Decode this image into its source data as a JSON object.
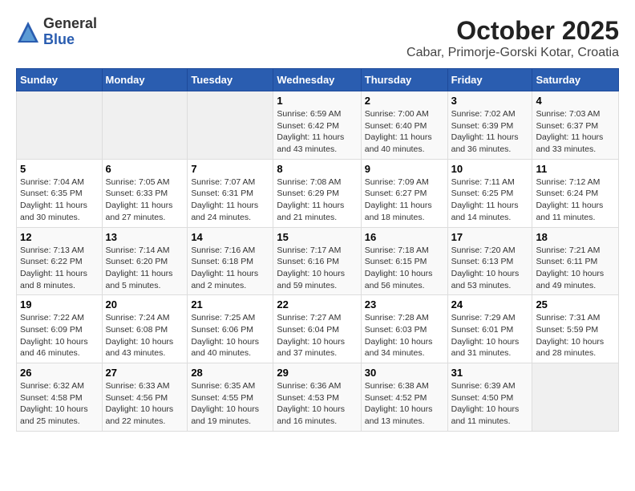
{
  "header": {
    "logo": {
      "general": "General",
      "blue": "Blue"
    },
    "title": "October 2025",
    "subtitle": "Cabar, Primorje-Gorski Kotar, Croatia"
  },
  "days_of_week": [
    "Sunday",
    "Monday",
    "Tuesday",
    "Wednesday",
    "Thursday",
    "Friday",
    "Saturday"
  ],
  "weeks": [
    [
      {
        "day": "",
        "info": ""
      },
      {
        "day": "",
        "info": ""
      },
      {
        "day": "",
        "info": ""
      },
      {
        "day": "1",
        "info": "Sunrise: 6:59 AM\nSunset: 6:42 PM\nDaylight: 11 hours\nand 43 minutes."
      },
      {
        "day": "2",
        "info": "Sunrise: 7:00 AM\nSunset: 6:40 PM\nDaylight: 11 hours\nand 40 minutes."
      },
      {
        "day": "3",
        "info": "Sunrise: 7:02 AM\nSunset: 6:39 PM\nDaylight: 11 hours\nand 36 minutes."
      },
      {
        "day": "4",
        "info": "Sunrise: 7:03 AM\nSunset: 6:37 PM\nDaylight: 11 hours\nand 33 minutes."
      }
    ],
    [
      {
        "day": "5",
        "info": "Sunrise: 7:04 AM\nSunset: 6:35 PM\nDaylight: 11 hours\nand 30 minutes."
      },
      {
        "day": "6",
        "info": "Sunrise: 7:05 AM\nSunset: 6:33 PM\nDaylight: 11 hours\nand 27 minutes."
      },
      {
        "day": "7",
        "info": "Sunrise: 7:07 AM\nSunset: 6:31 PM\nDaylight: 11 hours\nand 24 minutes."
      },
      {
        "day": "8",
        "info": "Sunrise: 7:08 AM\nSunset: 6:29 PM\nDaylight: 11 hours\nand 21 minutes."
      },
      {
        "day": "9",
        "info": "Sunrise: 7:09 AM\nSunset: 6:27 PM\nDaylight: 11 hours\nand 18 minutes."
      },
      {
        "day": "10",
        "info": "Sunrise: 7:11 AM\nSunset: 6:25 PM\nDaylight: 11 hours\nand 14 minutes."
      },
      {
        "day": "11",
        "info": "Sunrise: 7:12 AM\nSunset: 6:24 PM\nDaylight: 11 hours\nand 11 minutes."
      }
    ],
    [
      {
        "day": "12",
        "info": "Sunrise: 7:13 AM\nSunset: 6:22 PM\nDaylight: 11 hours\nand 8 minutes."
      },
      {
        "day": "13",
        "info": "Sunrise: 7:14 AM\nSunset: 6:20 PM\nDaylight: 11 hours\nand 5 minutes."
      },
      {
        "day": "14",
        "info": "Sunrise: 7:16 AM\nSunset: 6:18 PM\nDaylight: 11 hours\nand 2 minutes."
      },
      {
        "day": "15",
        "info": "Sunrise: 7:17 AM\nSunset: 6:16 PM\nDaylight: 10 hours\nand 59 minutes."
      },
      {
        "day": "16",
        "info": "Sunrise: 7:18 AM\nSunset: 6:15 PM\nDaylight: 10 hours\nand 56 minutes."
      },
      {
        "day": "17",
        "info": "Sunrise: 7:20 AM\nSunset: 6:13 PM\nDaylight: 10 hours\nand 53 minutes."
      },
      {
        "day": "18",
        "info": "Sunrise: 7:21 AM\nSunset: 6:11 PM\nDaylight: 10 hours\nand 49 minutes."
      }
    ],
    [
      {
        "day": "19",
        "info": "Sunrise: 7:22 AM\nSunset: 6:09 PM\nDaylight: 10 hours\nand 46 minutes."
      },
      {
        "day": "20",
        "info": "Sunrise: 7:24 AM\nSunset: 6:08 PM\nDaylight: 10 hours\nand 43 minutes."
      },
      {
        "day": "21",
        "info": "Sunrise: 7:25 AM\nSunset: 6:06 PM\nDaylight: 10 hours\nand 40 minutes."
      },
      {
        "day": "22",
        "info": "Sunrise: 7:27 AM\nSunset: 6:04 PM\nDaylight: 10 hours\nand 37 minutes."
      },
      {
        "day": "23",
        "info": "Sunrise: 7:28 AM\nSunset: 6:03 PM\nDaylight: 10 hours\nand 34 minutes."
      },
      {
        "day": "24",
        "info": "Sunrise: 7:29 AM\nSunset: 6:01 PM\nDaylight: 10 hours\nand 31 minutes."
      },
      {
        "day": "25",
        "info": "Sunrise: 7:31 AM\nSunset: 5:59 PM\nDaylight: 10 hours\nand 28 minutes."
      }
    ],
    [
      {
        "day": "26",
        "info": "Sunrise: 6:32 AM\nSunset: 4:58 PM\nDaylight: 10 hours\nand 25 minutes."
      },
      {
        "day": "27",
        "info": "Sunrise: 6:33 AM\nSunset: 4:56 PM\nDaylight: 10 hours\nand 22 minutes."
      },
      {
        "day": "28",
        "info": "Sunrise: 6:35 AM\nSunset: 4:55 PM\nDaylight: 10 hours\nand 19 minutes."
      },
      {
        "day": "29",
        "info": "Sunrise: 6:36 AM\nSunset: 4:53 PM\nDaylight: 10 hours\nand 16 minutes."
      },
      {
        "day": "30",
        "info": "Sunrise: 6:38 AM\nSunset: 4:52 PM\nDaylight: 10 hours\nand 13 minutes."
      },
      {
        "day": "31",
        "info": "Sunrise: 6:39 AM\nSunset: 4:50 PM\nDaylight: 10 hours\nand 11 minutes."
      },
      {
        "day": "",
        "info": ""
      }
    ]
  ]
}
